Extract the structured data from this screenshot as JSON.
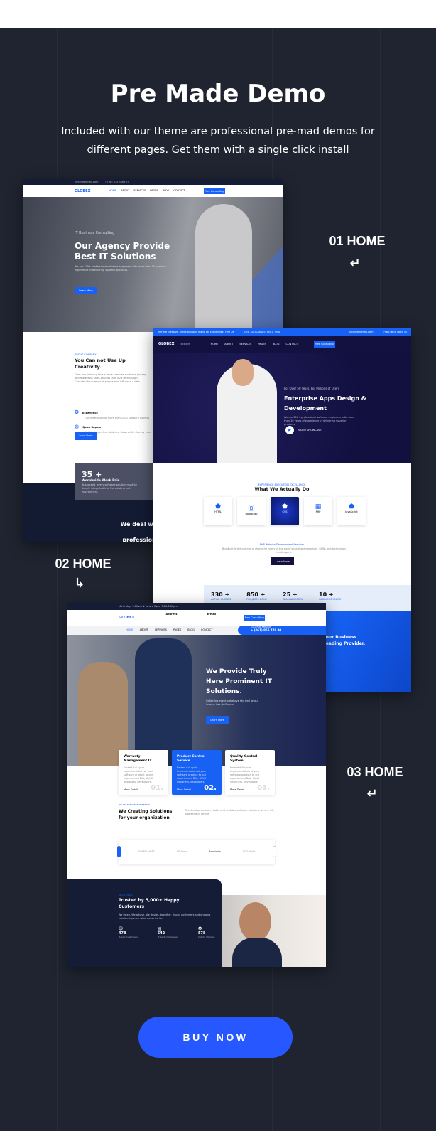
{
  "header": {
    "title": "Pre Made Demo",
    "subtitle": "Included with our theme are professional pre-mad demos for different pages. Get them with a",
    "subtitle_link": "single click install"
  },
  "labels": {
    "demo1": "01 HOME",
    "demo2": "02 HOME",
    "demo3": "03 HOME",
    "return_icon": "↵",
    "return_icon_alt": "↳"
  },
  "buy_button": "BUY NOW",
  "colors": {
    "background": "#1f2430",
    "accent": "#2757ff",
    "brand_blue": "#1762f5",
    "navy": "#14124a"
  },
  "demo1": {
    "brand": "GLOBEX",
    "email": "info@webmail.com",
    "phone": "(+88) 675 3869 75",
    "nav": [
      "HOME",
      "ABOUT",
      "SERVICES",
      "PAGES",
      "BLOG",
      "CONTACT"
    ],
    "cta": "Free Consulting",
    "hero_kicker": "IT Business Consulting",
    "hero_title": "Our Agency Provide Best IT Solutions",
    "hero_text": "We are 100+ professional software engineers with more than 10 years of experience in delivering superior products.",
    "hero_btn": "Learn More",
    "about_kicker": "ABOUT COMPANY",
    "about_title": "You Can not Use Up Creativity.",
    "about_text": "Does any industry face a more complex audience journey and marketing sales process than B2B technology? Consider the number of people who influence a sale.",
    "features": [
      {
        "title": "Experience",
        "text": "Our great team of more than 1400 software experts"
      },
      {
        "title": "Quick Support",
        "text": "We'll help you test bold new ideas while sharing your"
      }
    ],
    "video_btn": "Intro Video",
    "stat": "35 +",
    "stat_label": "Worldwide Work Pair",
    "stat_text": "To succeed, every software solution must be deeply integrated into the existing tech environment.",
    "dark_title": "We deal with t professional"
  },
  "demo2": {
    "topbar": "We are creative, ambitious and ready for challenges! Hire Us",
    "address": "125, SUITLAND STREET, USA",
    "email": "info@webmail.com",
    "phone": "(+88) 675 3869 75",
    "brand": "GLOBEX",
    "explore": "Explore",
    "nav": [
      "HOME",
      "ABOUT",
      "SERVICES",
      "PAGES",
      "BLOG",
      "CONTACT"
    ],
    "cta": "Free Consulting",
    "hero_kicker": "For Over 50 Years, For Millions of Users",
    "hero_title": "Enterprise Apps Design & Development",
    "hero_text": "We are 100+ professional software engineers with more than 10 years of experience in delivering superior products.",
    "video": "VIDEO SHOWCASE",
    "services_kicker": "EXPERIENCE EXECUTION EXCELLENCE",
    "services_title": "What We Actually Do",
    "services": [
      "HTML",
      "Bootstrap",
      "CSS",
      "PHP",
      "JavaScript"
    ],
    "services_sub": "PHP Website Development Services",
    "services_text": "BlogBuilt is the partner of choice for many of the world's leading enterprises, SMBs and technology challengers.",
    "services_btn": "Learn More",
    "stats": [
      {
        "value": "330 +",
        "label": "ACTIVE CLIENTS"
      },
      {
        "value": "850 +",
        "label": "PROJECTS DONE"
      },
      {
        "value": "25 +",
        "label": "TEAM ADVISORS"
      },
      {
        "value": "10 +",
        "label": "GLORIOUS YEARS"
      }
    ],
    "blue_title": "Your Business Leading Provider."
  },
  "demo3": {
    "hours": "Mo-Friday, 9.00am & 9a are Open 7.00-6.00pm",
    "brand": "GLOBEX",
    "address_label": "Address",
    "address": "125, Suitland Street, USA",
    "email_label": "E-Mail",
    "email": "support@globex.com",
    "cta": "Free Consulting",
    "nav": [
      "HOME",
      "ABOUT",
      "SERVICES",
      "PAGES",
      "BLOG",
      "CONTACT"
    ],
    "call_label": "CALL FOR SERVICE",
    "call": "+ (061) 855 479 90",
    "hero_title": "We Provide Truly Here Prominent IT Solutions.",
    "hero_text": "Collecting event old above shy bed favour income has staff since.",
    "hero_btn": "Learn More",
    "cards": [
      {
        "title": "Warranty Management IT",
        "num": "01.",
        "link": "More Detail"
      },
      {
        "title": "Product Control Service",
        "num": "02.",
        "link": "More Detail"
      },
      {
        "title": "Quality Control System",
        "num": "03.",
        "link": "More Detail"
      }
    ],
    "card_text": "Embed full-cycle implementation of your software product to our experienced BAs, UI/UX designers, developers.",
    "solutions_kicker": "WE TRANSFORM BUSINESSES",
    "solutions_title": "We Creating Solutions for your organization",
    "solutions_text": "The development of reliable and scalable software solutions for any OS, browser and device.",
    "partners": [
      "GREEN HOST",
      "SR Tech",
      "Boostoria",
      "ECO Wind"
    ],
    "trust_kicker": "About Hitech",
    "trust_title": "Trusted by 5,000+ Happy Customers",
    "trust_text": "We listen. We advise. We design, together. Happy customers and ongoing relationships are what we strive for.",
    "trust_stats": [
      {
        "value": "478",
        "label": "Happy Customers"
      },
      {
        "value": "642",
        "label": "Projects Completed"
      },
      {
        "value": "578",
        "label": "Clients Charges"
      }
    ]
  }
}
